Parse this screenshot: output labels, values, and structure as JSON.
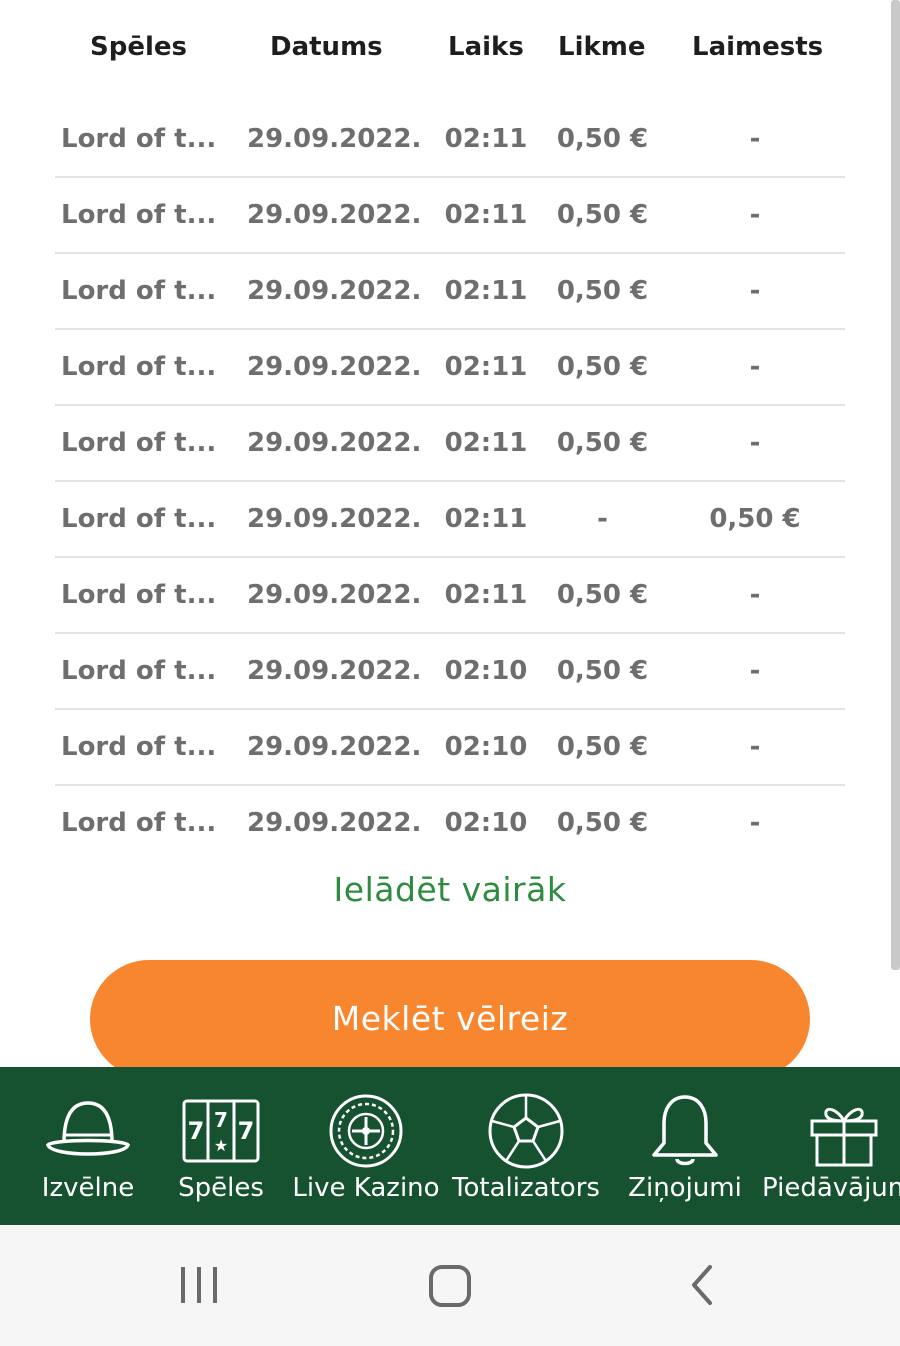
{
  "table": {
    "headers": {
      "game": "Spēles",
      "date": "Datums",
      "time": "Laiks",
      "bet": "Likme",
      "win": "Laimests"
    },
    "rows": [
      {
        "game": "Lord of t...",
        "date": "29.09.2022.",
        "time": "02:11",
        "bet": "0,50 €",
        "win": "-"
      },
      {
        "game": "Lord of t...",
        "date": "29.09.2022.",
        "time": "02:11",
        "bet": "0,50 €",
        "win": "-"
      },
      {
        "game": "Lord of t...",
        "date": "29.09.2022.",
        "time": "02:11",
        "bet": "0,50 €",
        "win": "-"
      },
      {
        "game": "Lord of t...",
        "date": "29.09.2022.",
        "time": "02:11",
        "bet": "0,50 €",
        "win": "-"
      },
      {
        "game": "Lord of t...",
        "date": "29.09.2022.",
        "time": "02:11",
        "bet": "0,50 €",
        "win": "-"
      },
      {
        "game": "Lord of t...",
        "date": "29.09.2022.",
        "time": "02:11",
        "bet": "-",
        "win": "0,50 €"
      },
      {
        "game": "Lord of t...",
        "date": "29.09.2022.",
        "time": "02:11",
        "bet": "0,50 €",
        "win": "-"
      },
      {
        "game": "Lord of t...",
        "date": "29.09.2022.",
        "time": "02:10",
        "bet": "0,50 €",
        "win": "-"
      },
      {
        "game": "Lord of t...",
        "date": "29.09.2022.",
        "time": "02:10",
        "bet": "0,50 €",
        "win": "-"
      },
      {
        "game": "Lord of t...",
        "date": "29.09.2022.",
        "time": "02:10",
        "bet": "0,50 €",
        "win": "-"
      }
    ]
  },
  "load_more": "Ielādēt vairāk",
  "search_again": "Meklēt vēlreiz",
  "bottom_nav": {
    "items": [
      {
        "label": "Izvēlne",
        "icon": "bowler-hat-icon"
      },
      {
        "label": "Spēles",
        "icon": "slot-machine-icon"
      },
      {
        "label": "Live Kazino",
        "icon": "roulette-wheel-icon"
      },
      {
        "label": "Totalizators",
        "icon": "soccer-ball-icon"
      },
      {
        "label": "Ziņojumi",
        "icon": "bell-icon"
      },
      {
        "label": "Piedāvājumi",
        "icon": "gift-icon"
      }
    ]
  },
  "system_nav": {
    "recent_apps": "recent-apps-icon",
    "home": "home-icon",
    "back": "back-icon"
  },
  "colors": {
    "accent_orange": "#f8862e",
    "nav_green": "#165130",
    "link_green": "#2e8b3f",
    "row_text": "#6e6e6e"
  }
}
